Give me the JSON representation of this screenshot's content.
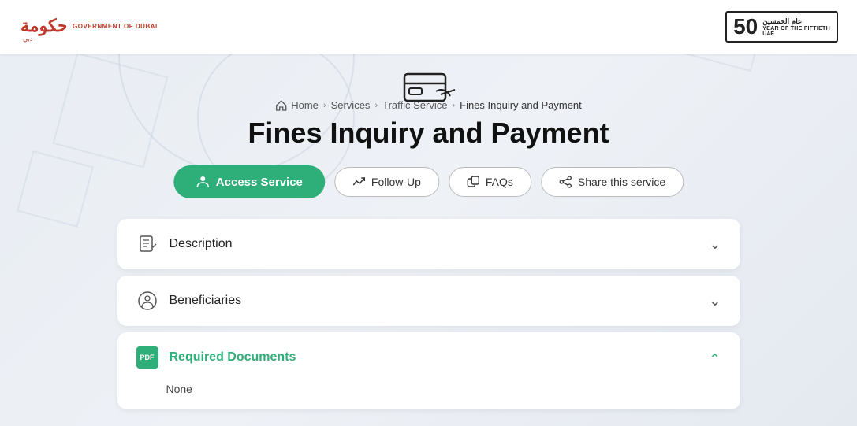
{
  "header": {
    "logo_alt": "Government of Dubai",
    "logo_text": "GOVERNMENT OF DUBAI",
    "badge_number": "50",
    "badge_year_ar": "عام الخمسين",
    "badge_year_en": "YEAR OF THE FIFTIETH",
    "badge_sub": "UAE"
  },
  "breadcrumb": {
    "home": "Home",
    "services": "Services",
    "traffic": "Traffic Service",
    "current": "Fines Inquiry and Payment"
  },
  "page": {
    "title": "Fines Inquiry and Payment"
  },
  "buttons": {
    "access": "Access Service",
    "followup": "Follow-Up",
    "faqs": "FAQs",
    "share": "Share this service"
  },
  "accordion": [
    {
      "id": "description",
      "label": "Description",
      "icon": "description-icon",
      "expanded": false,
      "content": ""
    },
    {
      "id": "beneficiaries",
      "label": "Beneficiaries",
      "icon": "beneficiaries-icon",
      "expanded": false,
      "content": ""
    },
    {
      "id": "required-documents",
      "label": "Required Documents",
      "icon": "pdf-icon",
      "expanded": true,
      "content": "None"
    }
  ]
}
